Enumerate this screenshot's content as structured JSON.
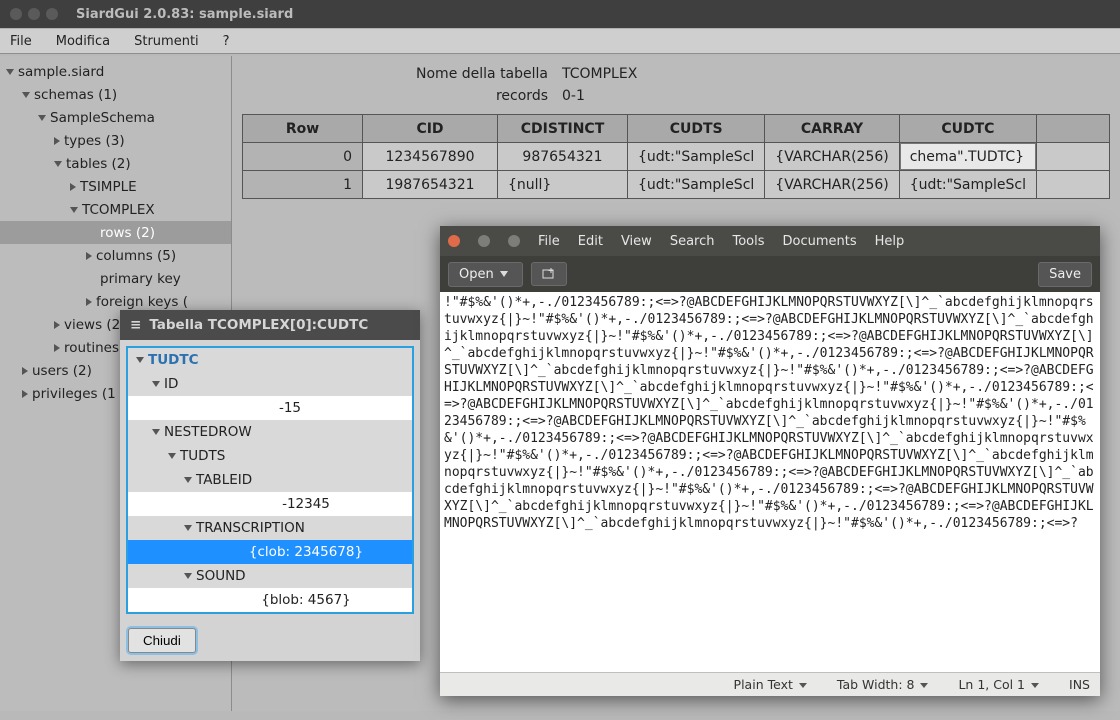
{
  "siard": {
    "title": "SiardGui 2.0.83: sample.siard",
    "menu": {
      "file": "File",
      "edit": "Modifica",
      "tools": "Strumenti",
      "help": "?"
    },
    "info": {
      "name_label": "Nome della tabella",
      "name_value": "TCOMPLEX",
      "records_label": "records",
      "records_value": "0-1"
    },
    "tree": {
      "root": "sample.siard",
      "schemas": "schemas (1)",
      "schema": "SampleSchema",
      "types": "types (3)",
      "tables": "tables (2)",
      "tsimple": "TSIMPLE",
      "tcomplex": "TCOMPLEX",
      "rows": "rows (2)",
      "columns": "columns (5)",
      "pk": "primary key",
      "fk": "foreign keys (",
      "views": "views (2)",
      "routines": "routines",
      "users": "users (2)",
      "privs": "privileges (1"
    },
    "table": {
      "headers": {
        "row": "Row",
        "cid": "CID",
        "cdist": "CDISTINCT",
        "cudts": "CUDTS",
        "carray": "CARRAY",
        "cudtc": "CUDTC"
      },
      "r0": {
        "row": "0",
        "cid": "1234567890",
        "cdist": "987654321",
        "cudts": "{udt:\"SampleScl",
        "carray": "{VARCHAR(256)",
        "cudtc": "chema\".TUDTC}"
      },
      "r1": {
        "row": "1",
        "cid": "1987654321",
        "cdist": "{null}",
        "cudts": "{udt:\"SampleScl",
        "carray": "{VARCHAR(256)",
        "cudtc": "{udt:\"SampleScl"
      }
    }
  },
  "popup": {
    "icon": "≡",
    "title": "Tabella TCOMPLEX[0]:CUDTC",
    "tudtc": "TUDTC",
    "id": "ID",
    "id_val": "-15",
    "nested": "NESTEDROW",
    "tudts": "TUDTS",
    "tableid": "TABLEID",
    "tableid_val": "-12345",
    "transcription": "TRANSCRIPTION",
    "transcription_val": "{clob: 2345678}",
    "sound": "SOUND",
    "sound_val": "{blob: 4567}",
    "close": "Chiudi"
  },
  "gedit": {
    "menu": {
      "file": "File",
      "edit": "Edit",
      "view": "View",
      "search": "Search",
      "tools": "Tools",
      "documents": "Documents",
      "help": "Help"
    },
    "open": "Open",
    "save": "Save",
    "status": {
      "lang": "Plain Text",
      "tab": "Tab Width: 8",
      "pos": "Ln 1, Col 1",
      "ins": "INS"
    },
    "content": "!\"#$%&'()*+,-./0123456789:;<=>?@ABCDEFGHIJKLMNOPQRSTUVWXYZ[\\]^_`abcdefghijklmnopqrstuvwxyz{|}~!\"#$%&'()*+,-./0123456789:;<=>?@ABCDEFGHIJKLMNOPQRSTUVWXYZ[\\]^_`abcdefghijklmnopqrstuvwxyz{|}~!\"#$%&'()*+,-./0123456789:;<=>?@ABCDEFGHIJKLMNOPQRSTUVWXYZ[\\]^_`abcdefghijklmnopqrstuvwxyz{|}~!\"#$%&'()*+,-./0123456789:;<=>?@ABCDEFGHIJKLMNOPQRSTUVWXYZ[\\]^_`abcdefghijklmnopqrstuvwxyz{|}~!\"#$%&'()*+,-./0123456789:;<=>?@ABCDEFGHIJKLMNOPQRSTUVWXYZ[\\]^_`abcdefghijklmnopqrstuvwxyz{|}~!\"#$%&'()*+,-./0123456789:;<=>?@ABCDEFGHIJKLMNOPQRSTUVWXYZ[\\]^_`abcdefghijklmnopqrstuvwxyz{|}~!\"#$%&'()*+,-./0123456789:;<=>?@ABCDEFGHIJKLMNOPQRSTUVWXYZ[\\]^_`abcdefghijklmnopqrstuvwxyz{|}~!\"#$%&'()*+,-./0123456789:;<=>?@ABCDEFGHIJKLMNOPQRSTUVWXYZ[\\]^_`abcdefghijklmnopqrstuvwxyz{|}~!\"#$%&'()*+,-./0123456789:;<=>?@ABCDEFGHIJKLMNOPQRSTUVWXYZ[\\]^_`abcdefghijklmnopqrstuvwxyz{|}~!\"#$%&'()*+,-./0123456789:;<=>?@ABCDEFGHIJKLMNOPQRSTUVWXYZ[\\]^_`abcdefghijklmnopqrstuvwxyz{|}~!\"#$%&'()*+,-./0123456789:;<=>?@ABCDEFGHIJKLMNOPQRSTUVWXYZ[\\]^_`abcdefghijklmnopqrstuvwxyz{|}~!\"#$%&'()*+,-./0123456789:;<=>?@ABCDEFGHIJKLMNOPQRSTUVWXYZ[\\]^_`abcdefghijklmnopqrstuvwxyz{|}~!\"#$%&'()*+,-./0123456789:;<=>?"
  }
}
